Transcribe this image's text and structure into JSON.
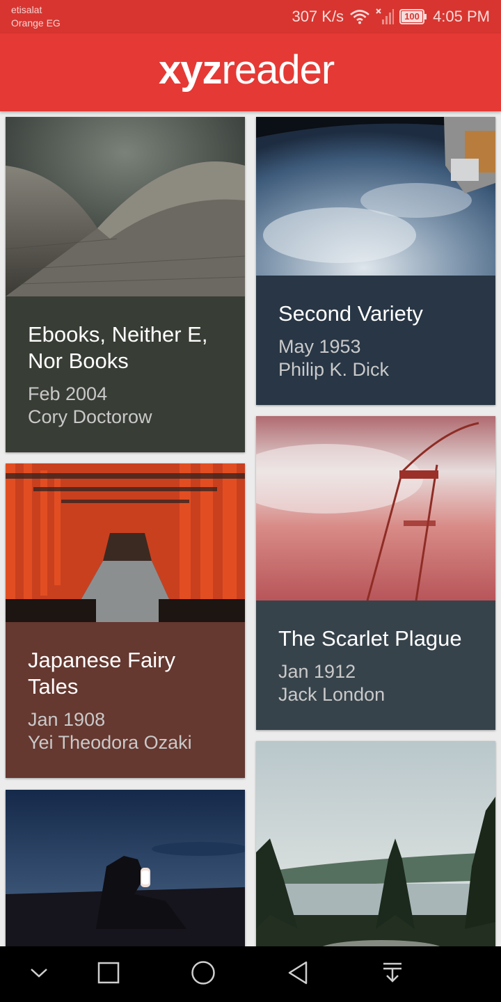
{
  "status_bar": {
    "carrier_line1": "etisalat",
    "carrier_line2": "Orange EG",
    "net_speed": "307 K/s",
    "battery": "100",
    "time": "4:05 PM"
  },
  "app_bar": {
    "logo_bold": "xyz",
    "logo_light": "reader"
  },
  "articles": [
    {
      "title": "Ebooks, Neither E, Nor Books",
      "date": "Feb 2004",
      "author": "Cory Doctorow",
      "color": "#383d35"
    },
    {
      "title": "Second Variety",
      "date": "May 1953",
      "author": "Philip K. Dick",
      "color": "#283645"
    },
    {
      "title": "Japanese Fairy Tales",
      "date": "Jan 1908",
      "author": "Yei Theodora Ozaki",
      "color": "#653830"
    },
    {
      "title": "The Scarlet Plague",
      "date": "Jan 1912",
      "author": "Jack London",
      "color": "#37434b"
    },
    {
      "title": "",
      "date": "",
      "author": "",
      "color": ""
    },
    {
      "title": "",
      "date": "",
      "author": "",
      "color": ""
    }
  ],
  "nav_bar": {
    "buttons": [
      "chevron-down-icon",
      "recents-icon",
      "home-icon",
      "back-icon",
      "notifications-pull-icon"
    ]
  },
  "colors": {
    "status_bar": "#d83530",
    "app_bar": "#e53935",
    "background": "#ececec"
  }
}
